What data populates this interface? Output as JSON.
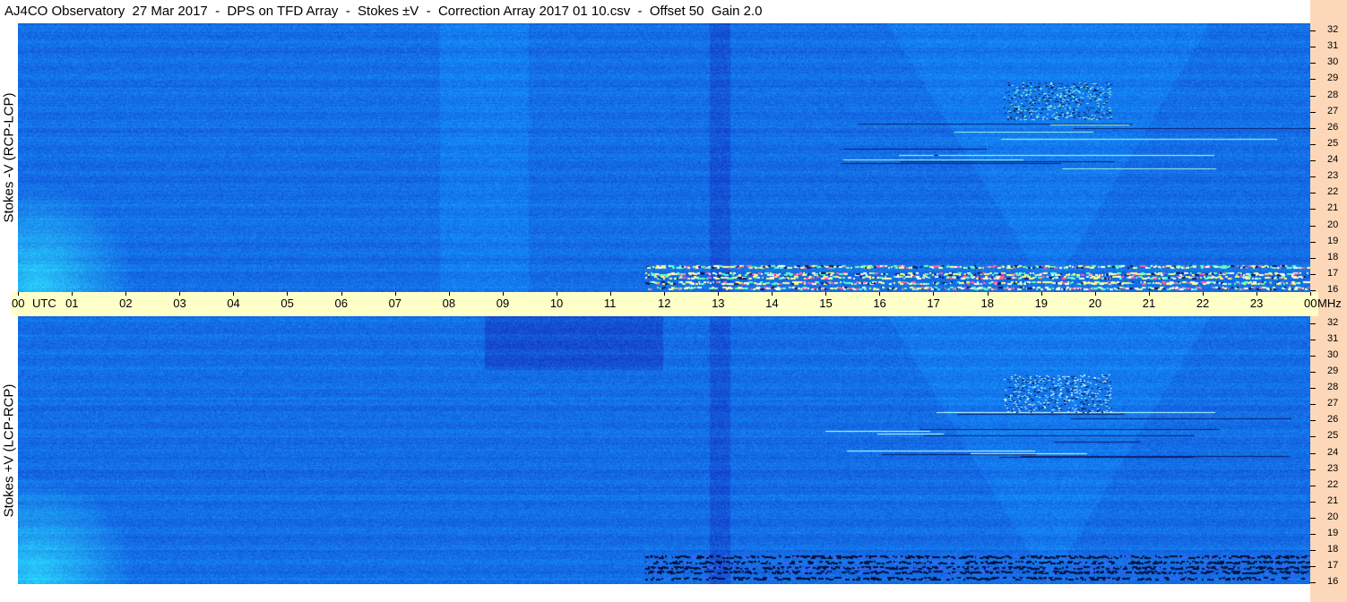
{
  "title": "AJ4CO Observatory  27 Mar 2017  -  DPS on TFD Array  -  Stokes ±V  -  Correction Array 2017 01 10.csv  -  Offset 50  Gain 2.0",
  "panels": [
    {
      "label": "Stokes -V (RCP-LCP)",
      "polarity": "minus"
    },
    {
      "label": "Stokes +V (LCP-RCP)",
      "polarity": "plus"
    }
  ],
  "time_axis": {
    "unit_label": "UTC",
    "ticks": [
      "00",
      "01",
      "02",
      "03",
      "04",
      "05",
      "06",
      "07",
      "08",
      "09",
      "10",
      "11",
      "12",
      "13",
      "14",
      "15",
      "16",
      "17",
      "18",
      "19",
      "20",
      "21",
      "22",
      "23",
      "00"
    ],
    "end_unit": "MHz"
  },
  "colors": {
    "background_blue": "#1f6fe8",
    "axis_band": "#ffffc8",
    "right_strip": "#fdd8b8"
  },
  "chart_data": [
    {
      "type": "heatmap",
      "title": "Stokes -V (RCP-LCP)",
      "x_unit": "UTC hour",
      "xlim": [
        0,
        24
      ],
      "y_unit": "MHz",
      "ylim": [
        16,
        32
      ],
      "x_ticks": [
        "00",
        "01",
        "02",
        "03",
        "04",
        "05",
        "06",
        "07",
        "08",
        "09",
        "10",
        "11",
        "12",
        "13",
        "14",
        "15",
        "16",
        "17",
        "18",
        "19",
        "20",
        "21",
        "22",
        "23",
        "00"
      ],
      "y_ticks": [
        16,
        17,
        18,
        19,
        20,
        21,
        22,
        23,
        24,
        25,
        26,
        27,
        28,
        29,
        30,
        31,
        32
      ]
    },
    {
      "type": "heatmap",
      "title": "Stokes +V (LCP-RCP)",
      "x_unit": "UTC hour",
      "xlim": [
        0,
        24
      ],
      "y_unit": "MHz",
      "ylim": [
        16,
        32
      ],
      "x_ticks": [
        "00",
        "01",
        "02",
        "03",
        "04",
        "05",
        "06",
        "07",
        "08",
        "09",
        "10",
        "11",
        "12",
        "13",
        "14",
        "15",
        "16",
        "17",
        "18",
        "19",
        "20",
        "21",
        "22",
        "23",
        "00"
      ],
      "y_ticks": [
        16,
        17,
        18,
        19,
        20,
        21,
        22,
        23,
        24,
        25,
        26,
        27,
        28,
        29,
        30,
        31,
        32
      ]
    }
  ]
}
